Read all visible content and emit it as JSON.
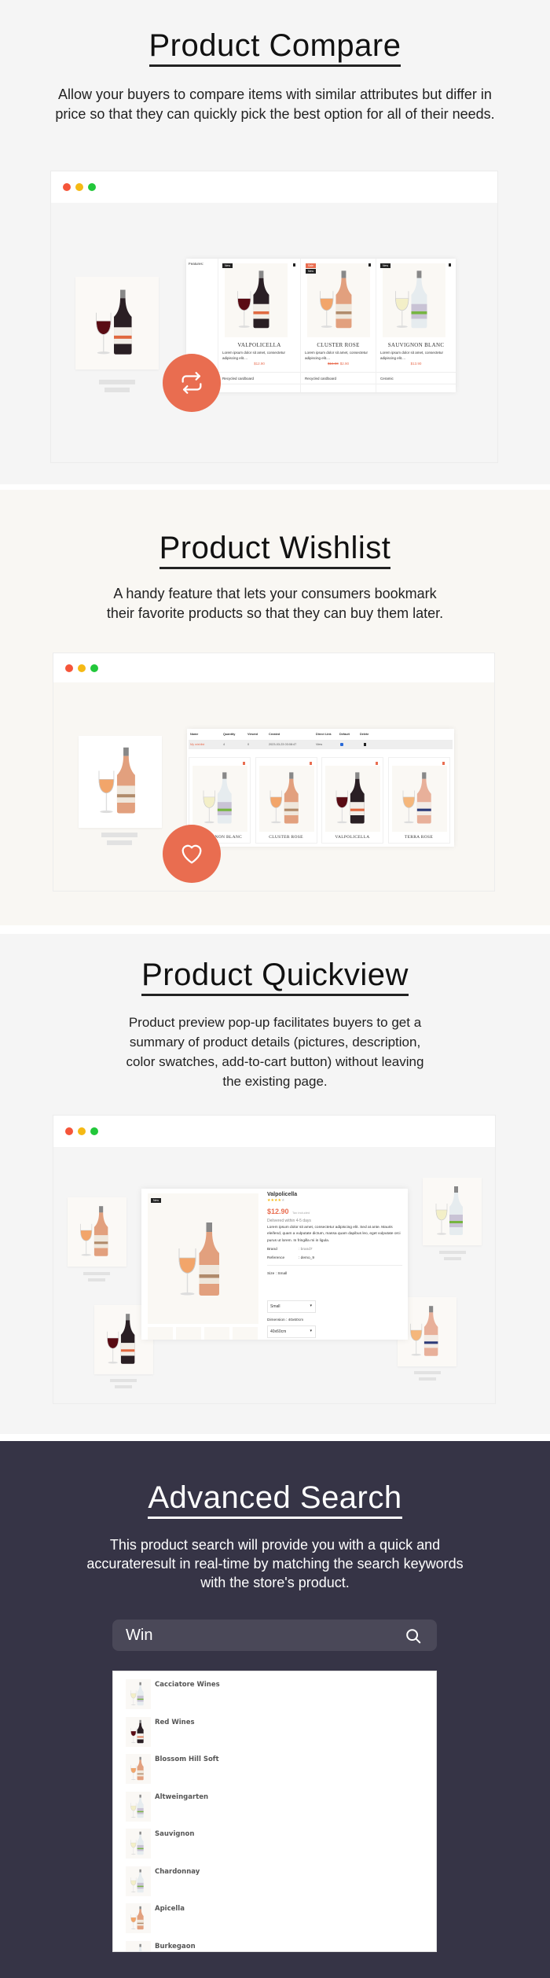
{
  "colors": {
    "accent": "#e96d50",
    "dark_bg": "#363446",
    "dot_red": "#f5553a",
    "dot_yellow": "#f5b914",
    "dot_green": "#22c73a"
  },
  "compare": {
    "title": "Product Compare",
    "description": "Allow your buyers to compare items with similar attributes but differ in price so that they can quickly pick the best option for all of their needs.",
    "icon": "compare-arrows-icon",
    "features_label": "Features:",
    "products": [
      {
        "name": "VALPOLICELLA",
        "desc": "Lorem ipsum dolor sit amet, consectetur adipiscing elit....",
        "price": "$12.90",
        "old_price": "",
        "badges": [
          "New"
        ],
        "material": "Recycled cardboard",
        "wine": "red"
      },
      {
        "name": "CLUSTER ROSE",
        "desc": "Lorem ipsum dolor sit amet, consectetur adipiscing elit....",
        "price": "$2.90",
        "old_price": "$16.90",
        "badges": [
          "Sale",
          "New"
        ],
        "material": "Recycled cardboard",
        "wine": "rose"
      },
      {
        "name": "SAUVIGNON BLANC",
        "desc": "Lorem ipsum dolor sit amet, consectetur adipiscing elit....",
        "price": "$13.90",
        "old_price": "",
        "badges": [
          "New"
        ],
        "material": "Ceramic",
        "wine": "white"
      }
    ]
  },
  "wishlist": {
    "title": "Product Wishlist",
    "description": "A handy feature that lets your consumers bookmark their favorite products so that they can buy them later.",
    "icon": "heart-icon",
    "columns": [
      "Name",
      "Quantity",
      "Viewed",
      "Created",
      "Direct Link",
      "Default",
      "Delete"
    ],
    "row": {
      "name": "My wishlist",
      "quantity": "4",
      "viewed": "0",
      "created": "2023-03-23 03:08:47",
      "link": "View",
      "default": true
    },
    "products": [
      {
        "name": "SAUVIGNON BLANC",
        "wine": "white"
      },
      {
        "name": "CLUSTER ROSE",
        "wine": "rose"
      },
      {
        "name": "VALPOLICELLA",
        "wine": "red"
      },
      {
        "name": "TERRA ROSE",
        "wine": "rose2"
      }
    ]
  },
  "quickview": {
    "title": "Product Quickview",
    "description": "Product preview pop-up facilitates buyers to get a summary of product details (pictures, description, color swatches, add-to-cart button) without leaving the existing page.",
    "product": {
      "badge": "New",
      "name": "Valpolicella",
      "rating": 4,
      "price": "$12.90",
      "tax": "Tax included",
      "delivery": "Delivered within 4-5 days",
      "desc": "Lorem ipsum dolor sit amet, consectetur adipiscing elit. Sed at ante. Mauris eleifend, quam a vulputate dictum, massa quam dapibus leo, eget vulputate orci purus ut lorem. In fringilla mi in ligula.",
      "brand_label": "Brand",
      "brand": ": brand7",
      "reference_label": "Reference",
      "reference": ": demo_9",
      "size_label": "Size : Small",
      "size": "Small",
      "dimension_label": "Dimension : 40x60cm",
      "dimension": "40x60cm"
    }
  },
  "search": {
    "title": "Advanced Search",
    "description": "This product search will provide you with a quick and accurateresult in real-time by matching the search keywords with the store's product.",
    "query": "Win",
    "icon": "search-icon",
    "results": [
      {
        "name": "Cacciatore Wines",
        "wine": "white"
      },
      {
        "name": "Red Wines",
        "wine": "red"
      },
      {
        "name": "Blossom Hill Soft",
        "wine": "rose"
      },
      {
        "name": "Altweingarten",
        "wine": "white"
      },
      {
        "name": "Sauvignon",
        "wine": "white"
      },
      {
        "name": "Chardonnay",
        "wine": "white"
      },
      {
        "name": "Apicella",
        "wine": "rose"
      },
      {
        "name": "Burkegaon",
        "wine": "white"
      }
    ]
  }
}
